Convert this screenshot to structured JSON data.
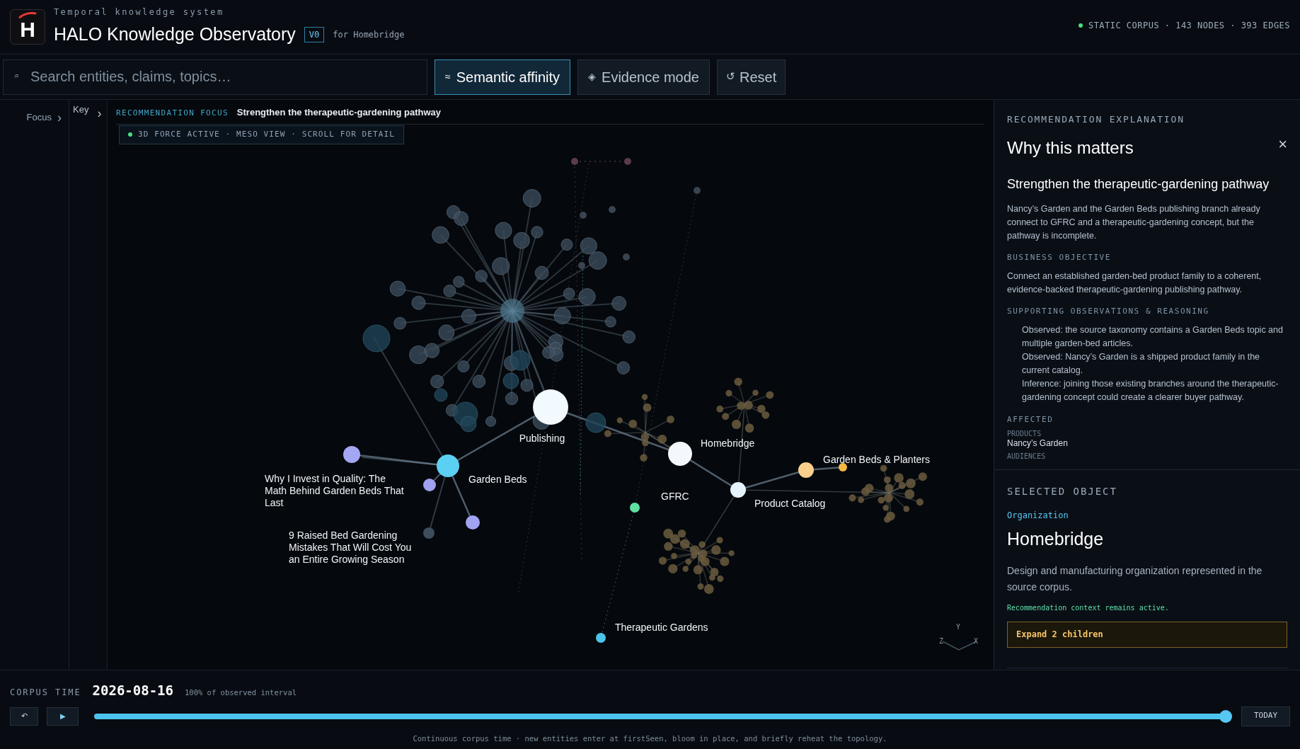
{
  "header": {
    "logo_letter": "H",
    "subtitle": "Temporal knowledge system",
    "title": "HALO Knowledge Observatory",
    "version": "V0",
    "context": "for Homebridge",
    "status": "STATIC CORPUS · 143 NODES · 393 EDGES"
  },
  "toolbar": {
    "search": {
      "icon": "⌕",
      "placeholder": "Search entities, claims, topics…"
    },
    "modes": [
      {
        "icon": "≈",
        "label": "Semantic affinity",
        "selected": true
      },
      {
        "icon": "◈",
        "label": "Evidence mode",
        "selected": false
      }
    ],
    "reset": {
      "icon": "↺",
      "label": "Reset"
    }
  },
  "side_tabs": [
    {
      "label": "Focus",
      "icon": "›"
    },
    {
      "label": "Key",
      "icon": "›"
    }
  ],
  "canvas": {
    "focus_label": "RECOMMENDATION FOCUS",
    "focus_title": "Strengthen the therapeutic-gardening pathway",
    "status_pill": "3D FORCE ACTIVE · MESO VIEW · SCROLL FOR DETAIL",
    "nodes": [
      {
        "label": "Publishing",
        "color": "#f2f9ff"
      },
      {
        "label": "Garden Beds",
        "color": "#5cd0f2"
      },
      {
        "label": "Why I Invest in Quality: The Math Behind Garden Beds That Last",
        "color": "#a4a7f4"
      },
      {
        "label": "9 Raised Bed Gardening Mistakes That Will Cost You an Entire Growing Season",
        "color": "#9fa3f2"
      },
      {
        "label": "Homebridge",
        "color": "#f4f8fc"
      },
      {
        "label": "GFRC",
        "color": "#5fe0a2"
      },
      {
        "label": "Product Catalog",
        "color": "#e4f3fd"
      },
      {
        "label": "Garden Beds & Planters",
        "color": "#fbd08c"
      },
      {
        "label": "Therapeutic Gardens",
        "color": "#4cc3e8"
      }
    ],
    "axes": [
      "Y",
      "Z",
      "X"
    ]
  },
  "explanation": {
    "eyebrow": "RECOMMENDATION EXPLANATION",
    "title": "Why this matters",
    "close": "×",
    "heading": "Strengthen the therapeutic-gardening pathway",
    "summary": "Nancy’s Garden and the Garden Beds publishing branch already connect to GFRC and a therapeutic-gardening concept, but the pathway is incomplete.",
    "objective_label": "BUSINESS OBJECTIVE",
    "objective": "Connect an established garden-bed product family to a coherent, evidence-backed therapeutic-gardening publishing pathway.",
    "reasoning_label": "SUPPORTING OBSERVATIONS & REASONING",
    "reasoning": [
      "Observed: the source taxonomy contains a Garden Beds topic and multiple garden-bed articles.",
      "Observed: Nancy’s Garden is a shipped product family in the current catalog.",
      "Inference: joining those existing branches around the therapeutic-gardening concept could create a clearer buyer pathway."
    ],
    "affected_label": "AFFECTED",
    "products_label": "PRODUCTS",
    "products": "Nancy’s Garden",
    "audiences_label": "AUDIENCES"
  },
  "selected_object": {
    "eyebrow": "SELECTED OBJECT",
    "type": "Organization",
    "name": "Homebridge",
    "description": "Design and manufacturing organization represented in the source corpus.",
    "note": "Recommendation context remains active.",
    "action": "Expand 2 children"
  },
  "timeline": {
    "label": "CORPUS TIME",
    "date": "2026-08-16",
    "coverage": "100% of observed interval",
    "back_icon": "↶",
    "play_icon": "▶",
    "level": 1,
    "today": "TODAY",
    "caption": "Continuous corpus time · new entities enter at firstSeen, bloom in place, and briefly reheat the topology."
  }
}
